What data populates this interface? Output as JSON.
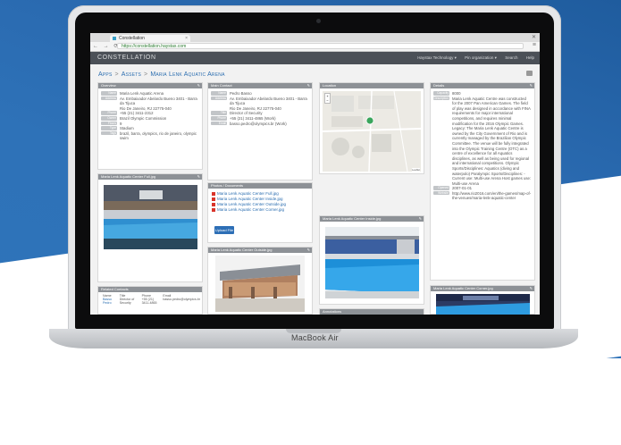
{
  "browser": {
    "tab_title": "Constellation",
    "url": "https://constellation.haystax.com"
  },
  "app": {
    "logo": "CONSTELLATION",
    "nav": [
      "Haystax Technology ▾",
      "Pin organization ▾",
      "Search",
      "Help"
    ]
  },
  "breadcrumb": [
    "Apps",
    "Assets",
    "Maria Lenk Aquatic Arena"
  ],
  "overview": {
    "title": "Overview",
    "fields": [
      {
        "k": "Name",
        "v": "Maria Lenk Aquatic Arena"
      },
      {
        "k": "Address",
        "v": "Av. Embaixador Abelardo Bueno 3401 - Barra da Tijuca"
      },
      {
        "k": "",
        "v": "Rio De Janeiro, RJ 22775-040"
      },
      {
        "k": "Phone",
        "v": "+55 (21) 3411-2312"
      },
      {
        "k": "Owner",
        "v": "Brazil Olympic Commission"
      },
      {
        "k": "Floors",
        "v": "9"
      },
      {
        "k": "Type",
        "v": "Stadium"
      },
      {
        "k": "Tags",
        "v": "brazil, barra, olympics, rio de janeiro, olympic swim"
      }
    ]
  },
  "main_contact": {
    "title": "Main Contact",
    "fields": [
      {
        "k": "Name",
        "v": "Pedro Basso"
      },
      {
        "k": "Address",
        "v": "Av. Embaixador Abelardo Bueno 3401 - Barra da Tijuca"
      },
      {
        "k": "",
        "v": "Rio De Janeiro, RJ 22775-040"
      },
      {
        "k": "Title",
        "v": "Director of Security"
      },
      {
        "k": "Phone",
        "v": "+55 (21) 3411-4865 (Work)"
      },
      {
        "k": "Email",
        "v": "basso.pedro@olympics.br (Work)"
      }
    ]
  },
  "location": {
    "title": "Location",
    "credit": "Leaflet"
  },
  "details": {
    "title": "Details",
    "fields": [
      {
        "k": "Capacity",
        "v": "8000"
      },
      {
        "k": "Description",
        "v": "Maria Lenk Aquatic Centre was constructed for the 2007 Pan American Games. The field of play was designed in accordance with FINA requirements for major international competitions, and requires minimal modification for the 2016 Olympic Games. Legacy: The Maria Lenk Aquatic Centre is owned by the City Government of Rio and is currently managed by the Brazilian Olympic Committee. The venue will be fully integrated into the Olympic Training Centre (OTC) as a centre of excellence for all Aquatics disciplines, as well as being used for regional and international competitions. Olympic Sports/Disciplines: Aquatics (diving and waterpolo) Paralympic Sports/Disciplines: - Current use: Multi-use Arena Host games use: Multi-use Arena"
      },
      {
        "k": "Opened",
        "v": "2007-01-01"
      },
      {
        "k": "Website",
        "v": "http://www.rio2016.com/en/the-games/map-of-the-venues/maria-lenk-aquatic-center"
      }
    ]
  },
  "photos": {
    "title": "Photos / Documents",
    "files": [
      "Maria Lenk Aquatic Center Full.jpg",
      "Maria Lenk Aquatic Center Inside.jpg",
      "Maria Lenk Aquatic Center Outside.jpg",
      "Maria Lenk Aquatic Center Corner.jpg"
    ],
    "upload_label": "Upload File"
  },
  "panels": {
    "full_photo": "Maria Lenk Aquatic Center Full.jpg",
    "outside_photo": "Maria Lenk Aquatic Center Outside.jpg",
    "inside_photo": "Maria Lenk Aquatic Center Inside.jpg",
    "corner_photo": "Maria Lenk Aquatic Center Corner.jpg",
    "annotations": "Annotations"
  },
  "related_contacts": {
    "title": "Related Contacts",
    "headers": [
      "Name",
      "Title",
      "Phone",
      "Email"
    ],
    "rows": [
      [
        "Basso Pedro",
        "Director of Security",
        "+55 (21) 3411-4865",
        "basso.pedro@olympics.br"
      ]
    ],
    "add_label": "Add Contact",
    "paging": "Showing 1 to 1 of 1 entries"
  },
  "laptop_label": "MacBook Air",
  "colors": {
    "header": "#4b5057",
    "panel_header": "#8d9196",
    "link": "#2a6db0",
    "button": "#2d6fb6",
    "brand_blue": "#2e72b8"
  }
}
